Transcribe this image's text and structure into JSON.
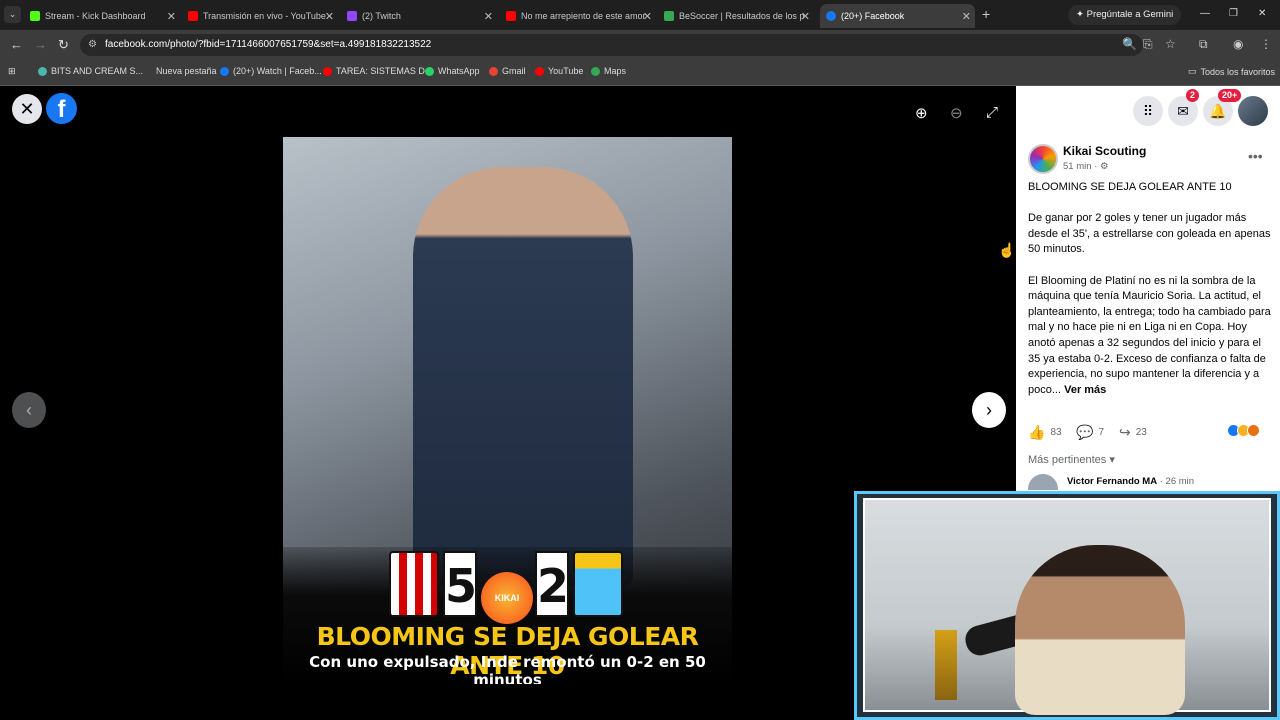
{
  "browser": {
    "tabs": [
      {
        "title": "Stream - Kick Dashboard",
        "color": "#53fc18",
        "active": false
      },
      {
        "title": "Transmisión en vivo - YouTube",
        "color": "#ff0000",
        "active": false
      },
      {
        "title": "(2) Twitch",
        "color": "#9146ff",
        "active": false
      },
      {
        "title": "No me arrepiento de este amor",
        "color": "#ff0000",
        "active": false
      },
      {
        "title": "BeSoccer | Resultados de los pa",
        "color": "#34a853",
        "active": false
      },
      {
        "title": "(20+) Facebook",
        "color": "#1877f2",
        "active": true
      }
    ],
    "new_tab": "+",
    "gemini_label": "Pregúntale a Gemini",
    "url": "facebook.com/photo/?fbid=1711466007651759&set=a.499181832213522",
    "bookmarks": [
      {
        "label": "BITS AND CREAM S...",
        "color": "#4db6ac"
      },
      {
        "label": "Nueva pestaña",
        "color": ""
      },
      {
        "label": "(20+) Watch | Faceb...",
        "color": "#1877f2"
      },
      {
        "label": "TAREA: SISTEMAS D...",
        "color": "#ff0000"
      },
      {
        "label": "WhatsApp",
        "color": "#25d366"
      },
      {
        "label": "Gmail",
        "color": "#ea4335"
      },
      {
        "label": "YouTube",
        "color": "#ff0000"
      },
      {
        "label": "Maps",
        "color": "#34a853"
      }
    ],
    "all_bookmarks": "Todos los favoritos"
  },
  "viewer": {
    "close": "✕",
    "logo": "f",
    "photo": {
      "score_home": "5",
      "score_away": "2",
      "badge": "KIKAI",
      "headline": "BLOOMING SE DEJA GOLEAR ANTE 10",
      "subline": "Con uno expulsado, Inde remontó un 0-2 en 50 minutos"
    },
    "prev": "‹",
    "next": "›"
  },
  "panel": {
    "messenger_badge": "2",
    "notif_badge": "20+",
    "page_name": "Kikai Scouting",
    "post_time": "51 min · ⚙",
    "post_title": "BLOOMING SE DEJA GOLEAR ANTE 10",
    "paragraph_1": "De ganar por 2 goles y tener un jugador más desde el 35', a estrellarse con goleada en apenas 50 minutos.",
    "paragraph_2": "El Blooming de Platiní no es ni la sombra de la máquina que tenía Mauricio Soria. La actitud, el planteamiento, la entrega; todo ha cambiado para mal y no hace pie ni en Liga ni en Copa. Hoy anotó apenas a 32 segundos del inicio y para el 35 ya estaba 0-2. Exceso de confianza o falta de experiencia, no supo mantener la diferencia y a poco...",
    "see_more": "Ver más",
    "likes": "83",
    "comments": "7",
    "shares": "23",
    "more_relevant": "Más pertinentes",
    "comment_author": "Victor Fernando MA",
    "comment_time": " · 26 min"
  }
}
